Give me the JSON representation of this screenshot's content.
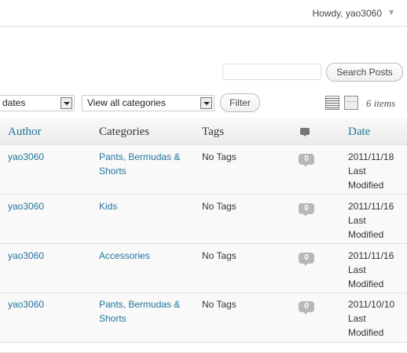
{
  "header": {
    "greeting": "Howdy, yao3060",
    "menu_arrow": "▼"
  },
  "search": {
    "placeholder": "",
    "button_label": "Search Posts"
  },
  "filters": {
    "dates_select": "dates",
    "categories_select": "View all categories",
    "filter_button": "Filter",
    "items_count": "6 items"
  },
  "table": {
    "columns": {
      "author": "Author",
      "categories": "Categories",
      "tags": "Tags",
      "date": "Date"
    },
    "rows": [
      {
        "author": "yao3060",
        "categories": [
          "Pants, Bermudas &",
          "Shorts"
        ],
        "tags": "No Tags",
        "comments": "0",
        "date": "2011/11/18",
        "date_status": [
          "Last",
          "Modified"
        ]
      },
      {
        "author": "yao3060",
        "categories": [
          "Kids"
        ],
        "tags": "No Tags",
        "comments": "0",
        "date": "2011/11/16",
        "date_status": [
          "Last",
          "Modified"
        ]
      },
      {
        "author": "yao3060",
        "categories": [
          "Accessories"
        ],
        "tags": "No Tags",
        "comments": "0",
        "date": "2011/11/16",
        "date_status": [
          "Last",
          "Modified"
        ]
      },
      {
        "author": "yao3060",
        "categories": [
          "Pants, Bermudas &",
          "Shorts"
        ],
        "tags": "No Tags",
        "comments": "0",
        "date": "2011/10/10",
        "date_status": [
          "Last",
          "Modified"
        ]
      }
    ]
  },
  "colors": {
    "link": "#21759b",
    "row_bg": "#f9f9f9",
    "badge": "#b8b8b8"
  }
}
